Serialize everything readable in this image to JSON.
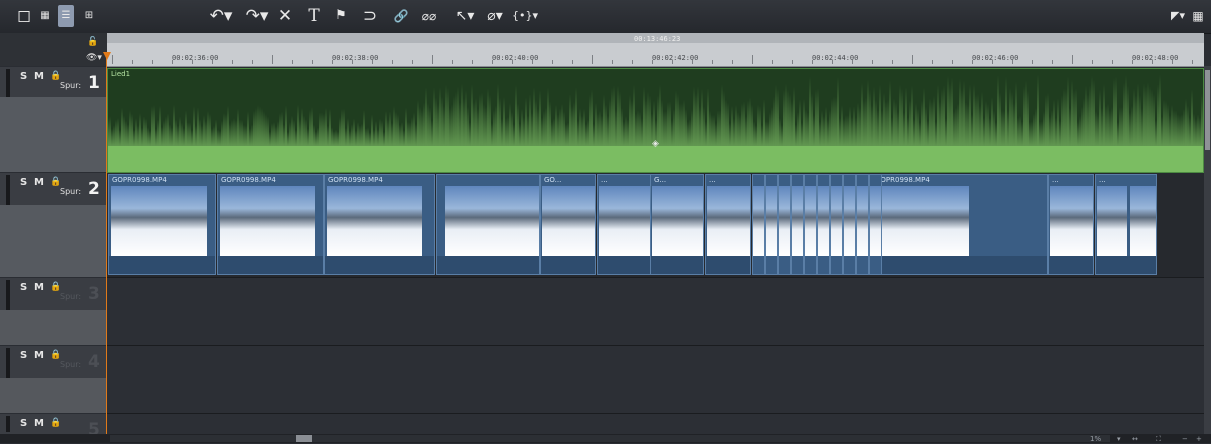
{
  "toolbar": {
    "left_icons": [
      "single-view-icon",
      "grid-view-icon",
      "list-view-icon",
      "tree-view-icon"
    ],
    "undo": "↶▾",
    "redo": "↷▾",
    "delete": "✕",
    "title_tool": "T",
    "marker": "⚑",
    "wrap": "⊃",
    "link": "🔗",
    "unlink": "⌀⌀",
    "mouse_mode": "↖▾",
    "eraser": "⌀▾",
    "fx": "{•}▾",
    "right_marker": "◤▾",
    "right_grid": "▦"
  },
  "ruler": {
    "playhead_time": "00:13:46:23",
    "labels": [
      "00:02:36:00",
      "00:02:38:00",
      "00:02:40:00",
      "00:02:42:00",
      "00:02:44:00",
      "00:02:46:00",
      "00:02:48:00"
    ]
  },
  "tracks": [
    {
      "s": "S",
      "m": "M",
      "lock": "🔒",
      "spur": "Spur:",
      "number": "1"
    },
    {
      "s": "S",
      "m": "M",
      "lock": "🔒",
      "spur": "Spur:",
      "number": "2"
    },
    {
      "s": "S",
      "m": "M",
      "lock": "🔒",
      "spur": "Spur:",
      "number": "3"
    },
    {
      "s": "S",
      "m": "M",
      "lock": "🔒",
      "spur": "Spur:",
      "number": "4"
    },
    {
      "s": "S",
      "m": "M",
      "lock": "🔒",
      "spur": "",
      "number": "5"
    }
  ],
  "audio_clip": {
    "label": "Lied1"
  },
  "video_clips": [
    {
      "label": "GOPR0998.MP4"
    },
    {
      "label": "GOPR0998.MP4"
    },
    {
      "label": "GOPR0998.MP4"
    },
    {
      "label": ""
    },
    {
      "label": "GO..."
    },
    {
      "label": "..."
    },
    {
      "label": "G..."
    },
    {
      "label": "..."
    },
    {
      "label": "GOPR0998.MP4"
    },
    {
      "label": "..."
    },
    {
      "label": "..."
    }
  ],
  "status": {
    "zoom": "1%"
  },
  "colors": {
    "audio": "#1f3d1f",
    "audio_band": "#7bbd62",
    "video": "#3a5d84",
    "playhead": "#e07a1a"
  }
}
